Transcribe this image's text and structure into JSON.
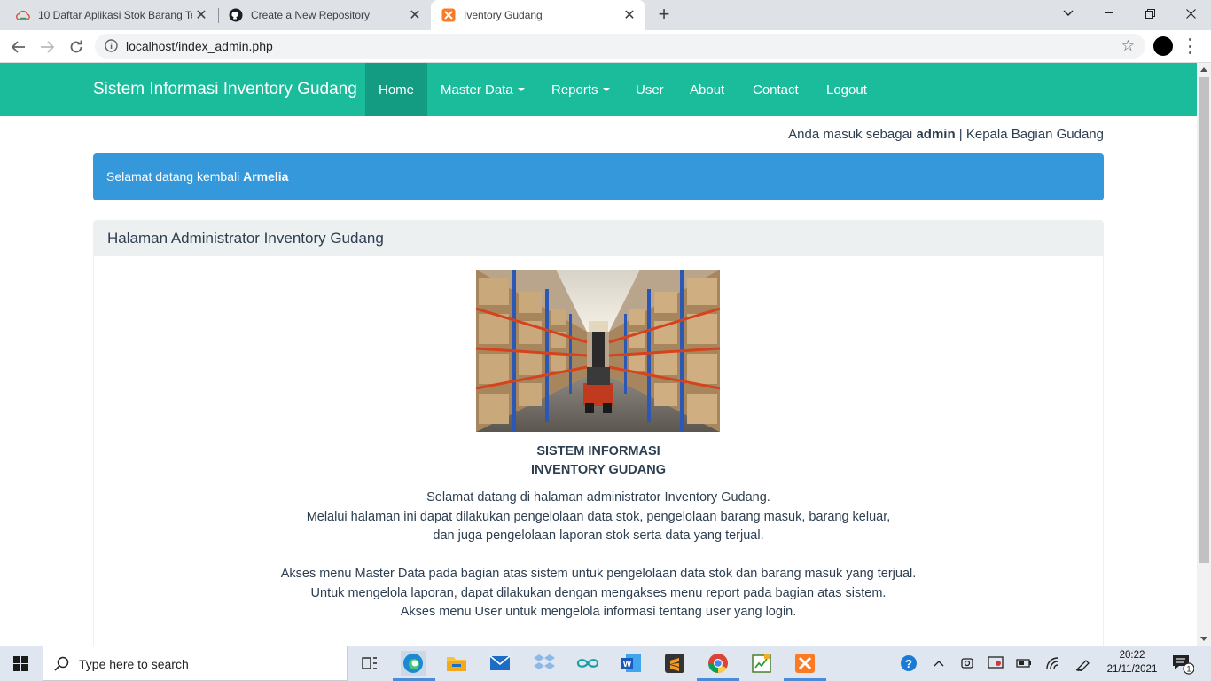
{
  "browser": {
    "tabs": [
      {
        "title": "10 Daftar Aplikasi Stok Barang Te",
        "icon": "cloud-icon",
        "active": false
      },
      {
        "title": "Create a New Repository",
        "icon": "github-icon",
        "active": false
      },
      {
        "title": "Iventory Gudang",
        "icon": "xampp-icon",
        "active": true
      }
    ],
    "url": "localhost/index_admin.php"
  },
  "site": {
    "brand": "Sistem Informasi Inventory Gudang",
    "nav": {
      "home": "Home",
      "master_data": "Master Data",
      "reports": "Reports",
      "user": "User",
      "about": "About",
      "contact": "Contact",
      "logout": "Logout"
    },
    "accent_color": "#1abc9c",
    "login_prefix": "Anda masuk sebagai",
    "login_user": "admin",
    "login_role": "| Kepala Bagian Gudang",
    "alert_prefix": "Selamat datang kembali",
    "alert_name": "Armelia",
    "alert_color": "#3498db",
    "panel_title": "Halaman Administrator Inventory Gudang",
    "heading_line1": "SISTEM INFORMASI",
    "heading_line2": "INVENTORY GUDANG",
    "para1": [
      "Selamat datang di halaman administrator Inventory Gudang.",
      "Melalui halaman ini dapat dilakukan pengelolaan data stok, pengelolaan barang masuk, barang keluar,",
      "dan juga pengelolaan laporan stok serta data yang terjual."
    ],
    "para2": [
      "Akses menu Master Data pada bagian atas sistem untuk pengelolaan data stok dan barang masuk yang terjual.",
      "Untuk mengelola laporan, dapat dilakukan dengan mengakses menu report pada bagian atas sistem.",
      "Akses menu User untuk mengelola informasi tentang user yang login."
    ]
  },
  "taskbar": {
    "search_placeholder": "Type here to search",
    "time": "20:22",
    "date": "21/11/2021",
    "notification_count": "1"
  }
}
